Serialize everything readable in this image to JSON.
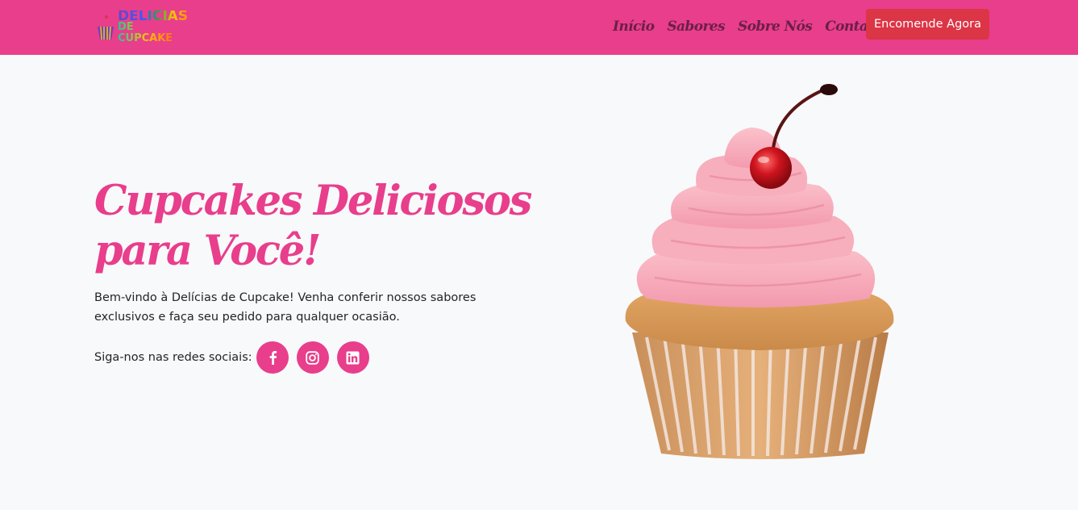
{
  "nav": {
    "logo": {
      "line1": "DELÍCIAS",
      "line2": "DE CUPCAKE",
      "icon": "cupcake-logo-icon"
    },
    "links": [
      "Início",
      "Sabores",
      "Sobre Nós",
      "Contato"
    ],
    "cta_label": "Encomende Agora"
  },
  "hero": {
    "title": "Cupcakes Deliciosos para Você!",
    "description": "Bem-vindo à Delícias de Cupcake! Venha conferir nossos sabores exclusivos e faça seu pedido para qualquer ocasião.",
    "social_label": "Siga-nos nas redes sociais:",
    "social": [
      {
        "name": "facebook",
        "icon": "facebook-icon"
      },
      {
        "name": "instagram",
        "icon": "instagram-icon"
      },
      {
        "name": "linkedin",
        "icon": "linkedin-icon"
      }
    ],
    "image": "cupcake-with-pink-frosting-and-cherry"
  },
  "colors": {
    "brand_pink": "#e83e8c",
    "cta_red": "#dc3545",
    "background": "#f8f9fa",
    "nav_link": "#6b1f46"
  }
}
